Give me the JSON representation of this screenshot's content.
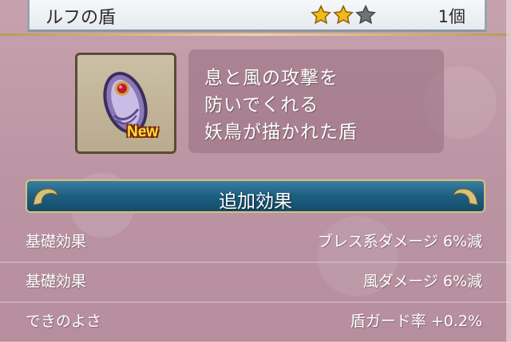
{
  "header": {
    "title": "ルフの盾",
    "stars_filled": 2,
    "stars_total": 3,
    "count": "1個"
  },
  "item": {
    "icon": "shield-icon",
    "badge": "New",
    "description": [
      "息と風の攻撃を",
      "防いでくれる",
      "妖鳥が描かれた盾"
    ]
  },
  "section": {
    "title": "追加効果"
  },
  "effects": [
    {
      "label": "基礎効果",
      "value": "ブレス系ダメージ 6%減"
    },
    {
      "label": "基礎効果",
      "value": "風ダメージ 6%減"
    },
    {
      "label": "できのよさ",
      "value": "盾ガード率 +0.2%"
    }
  ],
  "colors": {
    "background": "#bf9aa7",
    "banner": "#1d5e80",
    "star_gold": "#f2b81c",
    "star_gray": "#6f7378"
  }
}
